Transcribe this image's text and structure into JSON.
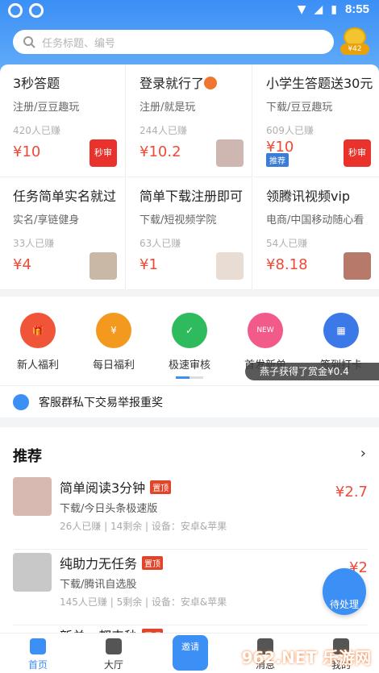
{
  "status": {
    "time": "8:55"
  },
  "search": {
    "placeholder": "任务标题、编号"
  },
  "wallet": {
    "amount": "¥42"
  },
  "tasks": [
    {
      "title": "3秒答题",
      "sub": "注册/豆豆趣玩",
      "earned": "420人已赚",
      "price": "¥10",
      "badge": "秒审"
    },
    {
      "title": "登录就行了",
      "sub": "注册/就是玩",
      "earned": "244人已赚",
      "price": "¥10.2"
    },
    {
      "title": "小学生答题送30元",
      "sub": "下载/豆豆趣玩",
      "earned": "609人已赚",
      "price": "¥10",
      "tag": "推荐",
      "badge": "秒审"
    },
    {
      "title": "任务简单实名就过",
      "sub": "实名/享链健身",
      "earned": "33人已赚",
      "price": "¥4"
    },
    {
      "title": "简单下载注册即可",
      "sub": "下载/短视频学院",
      "earned": "63人已赚",
      "price": "¥1"
    },
    {
      "title": "领腾讯视频vip",
      "sub": "电商/中国移动随心看",
      "earned": "54人已赚",
      "price": "¥8.18"
    }
  ],
  "shortcuts": [
    {
      "label": "新人福利",
      "color": "#f0553a"
    },
    {
      "label": "每日福利",
      "color": "#f39a1e",
      "glyph": "¥"
    },
    {
      "label": "极速审核",
      "color": "#2dbb5d"
    },
    {
      "label": "首发新单",
      "color": "#f25a8a",
      "glyph": "NEW"
    },
    {
      "label": "签到打卡",
      "color": "#3b78e8"
    }
  ],
  "toast": "燕子获得了赏金¥0.4",
  "notice": "客服群私下交易举报重奖",
  "recommend": {
    "title": "推荐",
    "items": [
      {
        "title": "简单阅读3分钟",
        "tag": "置顶",
        "sub": "下载/今日头条极速版",
        "meta": "26人已赚 | 14剩余 | 设备：安卓&苹果",
        "price": "¥2.7"
      },
      {
        "title": "纯助力无任务",
        "tag": "置顶",
        "sub": "下载/腾讯自选股",
        "meta": "145人已赚 | 5剩余 | 设备：安卓&苹果",
        "price": "¥2"
      },
      {
        "title": "新单，都来秒",
        "tag": "置顶"
      }
    ],
    "fab_label": "待处理"
  },
  "nav": {
    "home": "首页",
    "hall": "大厅",
    "invite": "邀请",
    "messages": "消息",
    "mine": "我的"
  },
  "watermark": "962.NET 乐游网"
}
